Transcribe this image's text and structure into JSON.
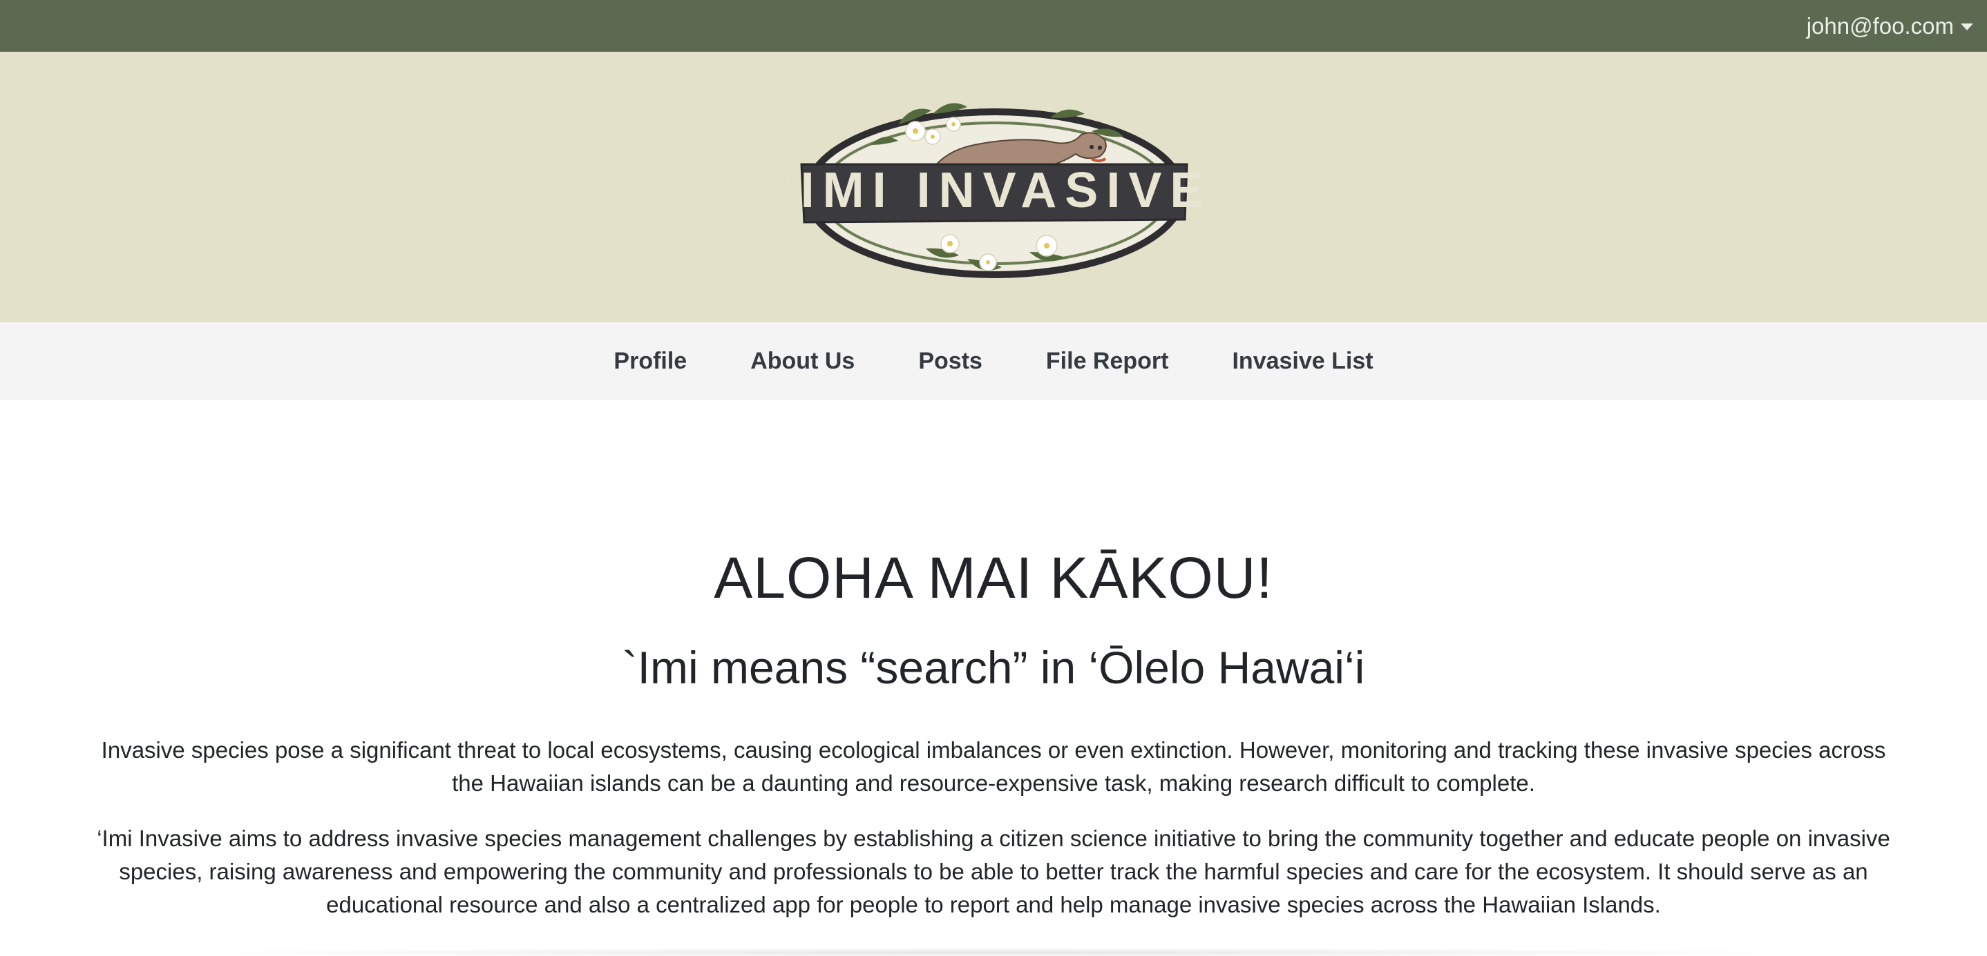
{
  "header": {
    "user_email": "john@foo.com"
  },
  "logo": {
    "text": "‘IMI INVASIVE"
  },
  "nav": {
    "items": [
      {
        "label": "Profile"
      },
      {
        "label": "About Us"
      },
      {
        "label": "Posts"
      },
      {
        "label": "File Report"
      },
      {
        "label": "Invasive List"
      }
    ]
  },
  "main": {
    "title": "ALOHA MAI KĀKOU!",
    "subtitle": "`Imi means “search” in ‘Ōlelo Hawai‘i",
    "paragraph_1": "Invasive species pose a significant threat to local ecosystems, causing ecological imbalances or even extinction. However, monitoring and tracking these invasive species across the Hawaiian islands can be a daunting and resource-expensive task, making research difficult to complete.",
    "paragraph_2": "‘Imi Invasive aims to address invasive species management challenges by establishing a citizen science initiative to bring the community together and educate people on invasive species, raising awareness and empowering the community and professionals to be able to better track the harmful species and care for the ecosystem. It should serve as an educational resource and also a centralized app for people to report and help manage invasive species across the Hawaiian Islands."
  },
  "colors": {
    "topbar": "#5b6a51",
    "banner": "#e3e1ca",
    "navbar": "#f4f4f4",
    "logo_band": "#3b3a3e",
    "logo_text": "#e8e6d2"
  }
}
